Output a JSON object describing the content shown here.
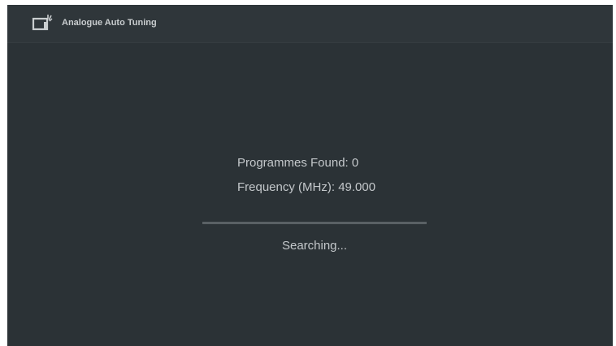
{
  "header": {
    "title": "Analogue Auto Tuning",
    "icon": "tv-antenna-icon"
  },
  "scan": {
    "programmes_found_label": "Programmes Found: 0",
    "frequency_label": "Frequency (MHz): 49.000",
    "progress": 0,
    "status": "Searching..."
  },
  "colors": {
    "background": "#2b3236",
    "header_background": "#2f363a",
    "text": "#c4c8cb",
    "progress_track": "#5a6165"
  }
}
